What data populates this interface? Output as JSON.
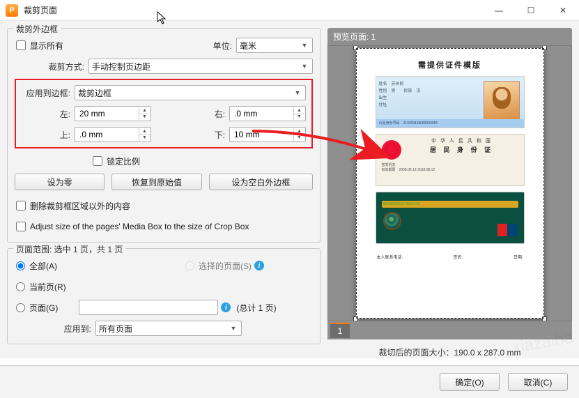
{
  "window": {
    "title": "裁剪页面"
  },
  "winbtns": {
    "min": "—",
    "max": "☐",
    "close": "✕"
  },
  "left": {
    "group_margins_title": "裁剪外边框",
    "show_all": {
      "label": "显示所有"
    },
    "unit": {
      "label": "单位:",
      "value": "毫米"
    },
    "crop_mode": {
      "label": "裁剪方式:",
      "value": "手动控制页边距"
    },
    "apply_to_box": {
      "label": "应用到边框:",
      "value": "裁剪边框"
    },
    "left_m": {
      "label": "左:",
      "value": "20 mm"
    },
    "right_m": {
      "label": "右:",
      "value": ".0 mm"
    },
    "top_m": {
      "label": "上:",
      "value": ".0 mm"
    },
    "bottom_m": {
      "label": "下:",
      "value": "10 mm"
    },
    "lock_ratio": {
      "label": "锁定比例"
    },
    "btn_zero": "设为零",
    "btn_restore": "恢复到原始值",
    "btn_blank": "设为空白外边框",
    "del_outside": {
      "label": "删除裁剪框区域以外的内容"
    },
    "adjust_media": {
      "label": "Adjust size of the pages' Media Box to the size of Crop Box"
    },
    "group_range_title": "页面范围: 选中 1 页，共 1 页",
    "r_all": {
      "label": "全部(A)"
    },
    "r_sel": {
      "label": "选择的页面(S)"
    },
    "r_cur": {
      "label": "当前页(R)"
    },
    "r_pages": {
      "label": "页面(G)"
    },
    "pages_input": "",
    "pages_total": "(总计 1 页)",
    "apply_to": {
      "label": "应用到:",
      "value": "所有页面"
    }
  },
  "preview": {
    "header": "预览页面: 1",
    "doc_title": "需提供证件模版",
    "card1_lines": "姓名　苏州民\n性别　男　　民族　汉\n出生\n住址\n\n",
    "card1_stripe": "公民身份号码　210203119689230055",
    "card2_l1": "中 华 人 民 共 和 国",
    "card2_l2": "居 民 身 份 证",
    "card2_det": "签发机关\n有效期限　2008.08.12-2018.08.12",
    "card3_num": "9560890131373015416",
    "foot_l": "本人联系电话:",
    "foot_m": "签名:",
    "foot_r": "日期:",
    "page_num": "1",
    "size_info": "裁切后的页面大小：190.0 x 287.0 mm"
  },
  "bottom": {
    "ok": "确定(O)",
    "cancel": "取消(C)"
  }
}
